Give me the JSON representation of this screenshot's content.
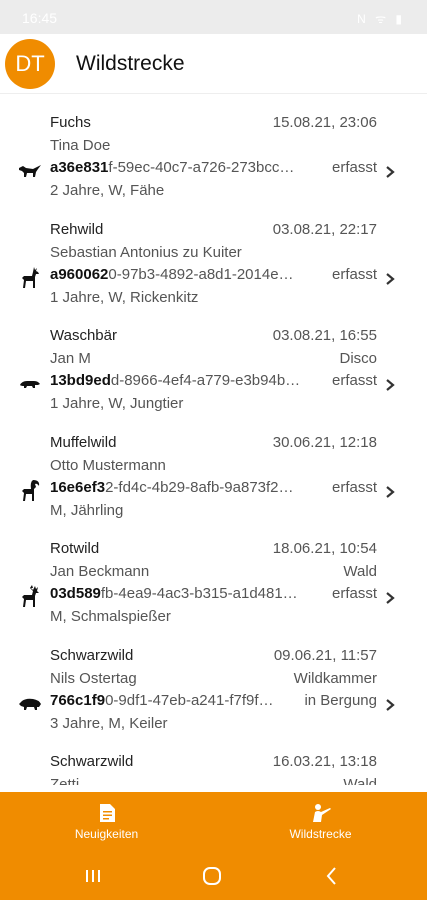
{
  "status": {
    "time": "16:45",
    "icons": "N ᯤ ▮"
  },
  "header": {
    "avatar_initials": "DT",
    "title": "Wildstrecke"
  },
  "entries": [
    {
      "species": "Fuchs",
      "datetime": "15.08.21, 23:06",
      "hunter": "Tina Doe",
      "location": "",
      "id_bold": "a36e831",
      "id_rest": "f-59ec-40c7-a726-273bcc…",
      "status": "erfasst",
      "details": "2 Jahre, W, Fähe",
      "icon": "fox-icon"
    },
    {
      "species": "Rehwild",
      "datetime": "03.08.21, 22:17",
      "hunter": "Sebastian Antonius zu Kuiter",
      "location": "",
      "id_bold": "a960062",
      "id_rest": "0-97b3-4892-a8d1-2014e…",
      "status": "erfasst",
      "details": "1 Jahre, W, Rickenkitz",
      "icon": "roe-deer-icon"
    },
    {
      "species": "Waschbär",
      "datetime": "03.08.21, 16:55",
      "hunter": "Jan M",
      "location": "Disco",
      "id_bold": "13bd9ed",
      "id_rest": "d-8966-4ef4-a779-e3b94b…",
      "status": "erfasst",
      "details": "1 Jahre, W, Jungtier",
      "icon": "raccoon-icon"
    },
    {
      "species": "Muffelwild",
      "datetime": "30.06.21, 12:18",
      "hunter": "Otto Mustermann",
      "location": "",
      "id_bold": "16e6ef3",
      "id_rest": "2-fd4c-4b29-8afb-9a873f2…",
      "status": "erfasst",
      "details": "M, Jährling",
      "icon": "mouflon-icon"
    },
    {
      "species": "Rotwild",
      "datetime": "18.06.21, 10:54",
      "hunter": "Jan Beckmann",
      "location": "Wald",
      "id_bold": "03d589",
      "id_rest": "fb-4ea9-4ac3-b315-a1d481…",
      "status": "erfasst",
      "details": "M, Schmalspießer",
      "icon": "red-deer-icon"
    },
    {
      "species": "Schwarzwild",
      "datetime": "09.06.21, 11:57",
      "hunter": "Nils Ostertag",
      "location": "Wildkammer",
      "id_bold": "766c1f9",
      "id_rest": "0-9df1-47eb-a241-f7f9f…",
      "status": "in Bergung",
      "details": "3 Jahre, M, Keiler",
      "icon": "wild-boar-icon"
    },
    {
      "species": "Schwarzwild",
      "datetime": "16.03.21, 13:18",
      "hunter": "Zetti",
      "location": "Wald",
      "id_bold": "",
      "id_rest": "",
      "status": "",
      "details": "",
      "icon": "wild-boar-icon"
    }
  ],
  "bottom_nav": {
    "news_label": "Neuigkeiten",
    "bag_label": "Wildstrecke",
    "accent": "#f08c00"
  }
}
